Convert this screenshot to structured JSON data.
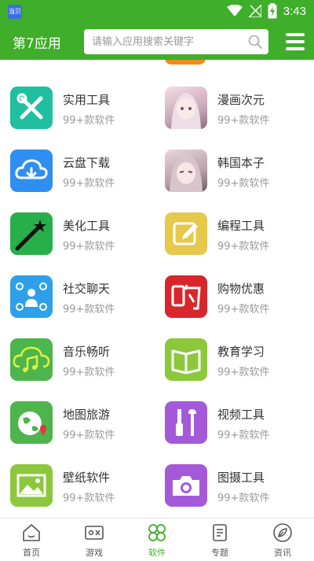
{
  "status_bar": {
    "time": "3:43",
    "app_icon_text": "当贝",
    "icons": [
      "wifi-icon",
      "no-signal-icon",
      "battery-charging-icon"
    ]
  },
  "header": {
    "title": "第7应用",
    "search_placeholder": "请输入应用搜索关键字",
    "search_icon": "search-icon",
    "menu_icon": "menu-icon"
  },
  "categories": [
    {
      "name": "实用工具",
      "count": "99+款软件",
      "icon": "tools-icon",
      "color": "#1fbf9f"
    },
    {
      "name": "漫画次元",
      "count": "99+款软件",
      "icon": "anime-girl-thumbnail",
      "color": "#e8c7d6"
    },
    {
      "name": "云盘下载",
      "count": "99+款软件",
      "icon": "cloud-download-icon",
      "color": "#2f8ff0"
    },
    {
      "name": "韩国本子",
      "count": "99+款软件",
      "icon": "anime-girl-thumbnail",
      "color": "#d9c2c9"
    },
    {
      "name": "美化工具",
      "count": "99+款软件",
      "icon": "magic-wand-icon",
      "color": "#27b04a"
    },
    {
      "name": "编程工具",
      "count": "99+款软件",
      "icon": "edit-pencil-icon",
      "color": "#e6c84a"
    },
    {
      "name": "社交聊天",
      "count": "99+款软件",
      "icon": "social-network-icon",
      "color": "#2fa0e8"
    },
    {
      "name": "购物优惠",
      "count": "99+款软件",
      "icon": "shopping-gou-icon",
      "color": "#d8262a"
    },
    {
      "name": "音乐畅听",
      "count": "99+款软件",
      "icon": "music-cloud-icon",
      "color": "#4cb54c"
    },
    {
      "name": "教育学习",
      "count": "99+款软件",
      "icon": "open-book-icon",
      "color": "#8cc83c"
    },
    {
      "name": "地图旅游",
      "count": "99+款软件",
      "icon": "globe-pin-icon",
      "color": "#4cb54c"
    },
    {
      "name": "视频工具",
      "count": "99+款软件",
      "icon": "wrench-screwdriver-icon",
      "color": "#a45ad8"
    },
    {
      "name": "壁纸软件",
      "count": "99+款软件",
      "icon": "picture-icon",
      "color": "#8cc83c"
    },
    {
      "name": "图摄工具",
      "count": "99+款软件",
      "icon": "camera-icon",
      "color": "#a45ad8"
    }
  ],
  "tabs": [
    {
      "label": "首页",
      "icon": "home-icon",
      "active": false
    },
    {
      "label": "游戏",
      "icon": "game-controller-icon",
      "active": false
    },
    {
      "label": "软件",
      "icon": "apps-grid-icon",
      "active": true
    },
    {
      "label": "专题",
      "icon": "topics-icon",
      "active": false
    },
    {
      "label": "资讯",
      "icon": "news-leaf-icon",
      "active": false
    }
  ],
  "colors": {
    "brand_green": "#3fae2a",
    "text_primary": "#333333",
    "text_secondary": "#9a9a9a",
    "scroll_peek": "#f08a1c"
  }
}
